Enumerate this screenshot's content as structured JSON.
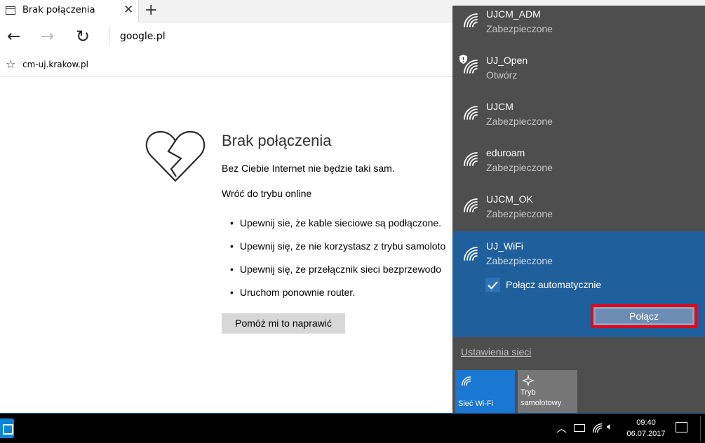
{
  "browser": {
    "tab_title": "Brak połączenia",
    "tab_close": "✕",
    "new_tab": "+",
    "address": "google.pl",
    "favorite": "cm-uj.krakow.pl"
  },
  "page": {
    "title": "Brak połączenia",
    "subtitle": "Bez Ciebie Internet nie będzie taki sam.",
    "online_heading": "Wróć do trybu online",
    "tips": [
      "Upewnij sie, że kable sieciowe są podłączone.",
      "Upewnij się, że nie korzystasz z trybu samoloto",
      "Upewnij się, że przełącznik sieci bezprzewodo",
      "Uruchom ponownie router."
    ],
    "fix_button": "Pomóż mi to naprawić"
  },
  "networks": [
    {
      "name": "UJCM_ADM",
      "status": "Zabezpieczone",
      "open": false
    },
    {
      "name": "UJ_Open",
      "status": "Otwórz",
      "open": true
    },
    {
      "name": "UJCM",
      "status": "Zabezpieczone",
      "open": false
    },
    {
      "name": "eduroam",
      "status": "Zabezpieczone",
      "open": false
    },
    {
      "name": "UJCM_OK",
      "status": "Zabezpieczone",
      "open": false
    }
  ],
  "selected_network": {
    "name": "UJ_WiFi",
    "status": "Zabezpieczone",
    "auto_connect_label": "Połącz automatycznie",
    "auto_connect_checked": true,
    "connect_button": "Połącz"
  },
  "network_settings": "Ustawienia sieci",
  "quick_actions": [
    {
      "label": "Sieć Wi-Fi",
      "icon": "wifi-icon",
      "active": true
    },
    {
      "label": "Tryb samolotowy",
      "icon": "airplane-icon",
      "active": false
    }
  ],
  "taskbar": {
    "time": "09:40",
    "date": "06.07.2017"
  },
  "colors": {
    "flyout_bg": "#4e4e4e",
    "selected_bg": "#1f5f9b",
    "accent": "#1a77d2",
    "highlight_border": "#e3061a"
  }
}
